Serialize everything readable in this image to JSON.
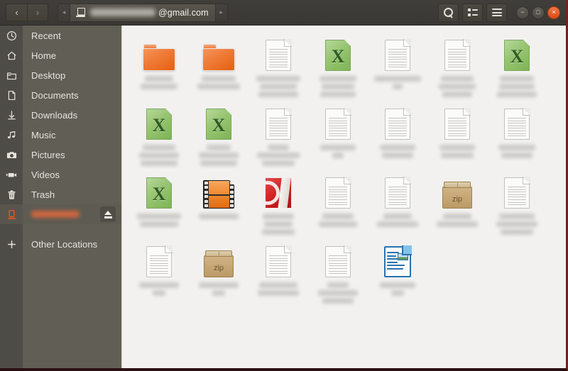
{
  "window": {
    "title_path_suffix": "@gmail.com",
    "accent_color": "#e95420",
    "header_bg": "#3d3b37",
    "sidebar_bg": "#615f55",
    "sidebar_icon_bg": "#4e4c46",
    "content_bg": "#f2f1f0",
    "window_border": "#6e2419"
  },
  "header": {
    "back_label": "‹",
    "forward_label": "›",
    "path_left_arrow": "◂",
    "path_right_arrow": "▸",
    "path_icon": "drive-icon",
    "path_text": "@gmail.com",
    "search_icon": "search-icon",
    "view_icon": "list-view-icon",
    "menu_icon": "hamburger-menu-icon",
    "minimize_label": "−",
    "maximize_label": "□",
    "close_label": "×"
  },
  "sidebar": {
    "items": [
      {
        "label": "Recent",
        "icon": "clock-icon",
        "type": "place"
      },
      {
        "label": "Home",
        "icon": "home-icon",
        "type": "place"
      },
      {
        "label": "Desktop",
        "icon": "folder-icon",
        "type": "place"
      },
      {
        "label": "Documents",
        "icon": "document-icon",
        "type": "place"
      },
      {
        "label": "Downloads",
        "icon": "download-icon",
        "type": "place"
      },
      {
        "label": "Music",
        "icon": "music-note-icon",
        "type": "place"
      },
      {
        "label": "Pictures",
        "icon": "camera-icon",
        "type": "place"
      },
      {
        "label": "Videos",
        "icon": "camcorder-icon",
        "type": "place"
      },
      {
        "label": "Trash",
        "icon": "trash-icon",
        "type": "place"
      }
    ],
    "mounted_drive": {
      "label": "",
      "label_redacted": true,
      "icon": "drive-icon",
      "eject_icon": "eject-icon",
      "active": true
    },
    "other_locations": {
      "label": "Other Locations",
      "icon": "plus-icon"
    }
  },
  "files": {
    "columns": 7,
    "items": [
      {
        "type": "folder",
        "name_redacted": true,
        "name_lines": [
          40,
          52
        ]
      },
      {
        "type": "folder",
        "name_redacted": true,
        "name_lines": [
          48,
          60
        ]
      },
      {
        "type": "document",
        "name_redacted": true,
        "name_lines": [
          62,
          52,
          56
        ]
      },
      {
        "type": "xls",
        "name_redacted": true,
        "name_lines": [
          52,
          46,
          50
        ]
      },
      {
        "type": "document",
        "name_redacted": true,
        "name_lines": [
          66,
          14
        ]
      },
      {
        "type": "document",
        "name_redacted": true,
        "name_lines": [
          46,
          52,
          42
        ]
      },
      {
        "type": "xls",
        "name_redacted": true,
        "name_lines": [
          48,
          50,
          56
        ]
      },
      {
        "type": "xls",
        "name_redacted": true,
        "name_lines": [
          46,
          56,
          52
        ]
      },
      {
        "type": "xls",
        "name_redacted": true,
        "name_lines": [
          34,
          56,
          52
        ]
      },
      {
        "type": "document",
        "name_redacted": true,
        "name_lines": [
          30,
          60,
          46
        ]
      },
      {
        "type": "document",
        "name_redacted": true,
        "name_lines": [
          50,
          16
        ]
      },
      {
        "type": "document",
        "name_redacted": true,
        "name_lines": [
          50,
          44
        ]
      },
      {
        "type": "document",
        "name_redacted": true,
        "name_lines": [
          50,
          46
        ]
      },
      {
        "type": "document",
        "name_redacted": true,
        "name_lines": [
          52,
          44
        ]
      },
      {
        "type": "xls",
        "name_redacted": true,
        "name_lines": [
          62,
          54
        ]
      },
      {
        "type": "video",
        "name_redacted": true,
        "name_lines": [
          56
        ]
      },
      {
        "type": "pdf",
        "name_redacted": true,
        "name_lines": [
          44,
          40,
          46
        ]
      },
      {
        "type": "document",
        "name_redacted": true,
        "name_lines": [
          44,
          54
        ]
      },
      {
        "type": "document",
        "name_redacted": true,
        "name_lines": [
          40,
          58
        ]
      },
      {
        "type": "zip",
        "name_redacted": true,
        "name_lines": [
          40,
          58
        ]
      },
      {
        "type": "document",
        "name_redacted": true,
        "name_lines": [
          50,
          58,
          46
        ]
      },
      {
        "type": "document",
        "name_redacted": true,
        "name_lines": [
          56,
          18
        ]
      },
      {
        "type": "zip",
        "name_redacted": true,
        "name_lines": [
          56,
          18
        ]
      },
      {
        "type": "document",
        "name_redacted": true,
        "name_lines": [
          54,
          58
        ]
      },
      {
        "type": "document",
        "name_redacted": true,
        "name_lines": [
          30,
          56,
          44
        ]
      },
      {
        "type": "libreoffice",
        "name_redacted": true,
        "name_lines": [
          50,
          18
        ]
      }
    ]
  }
}
